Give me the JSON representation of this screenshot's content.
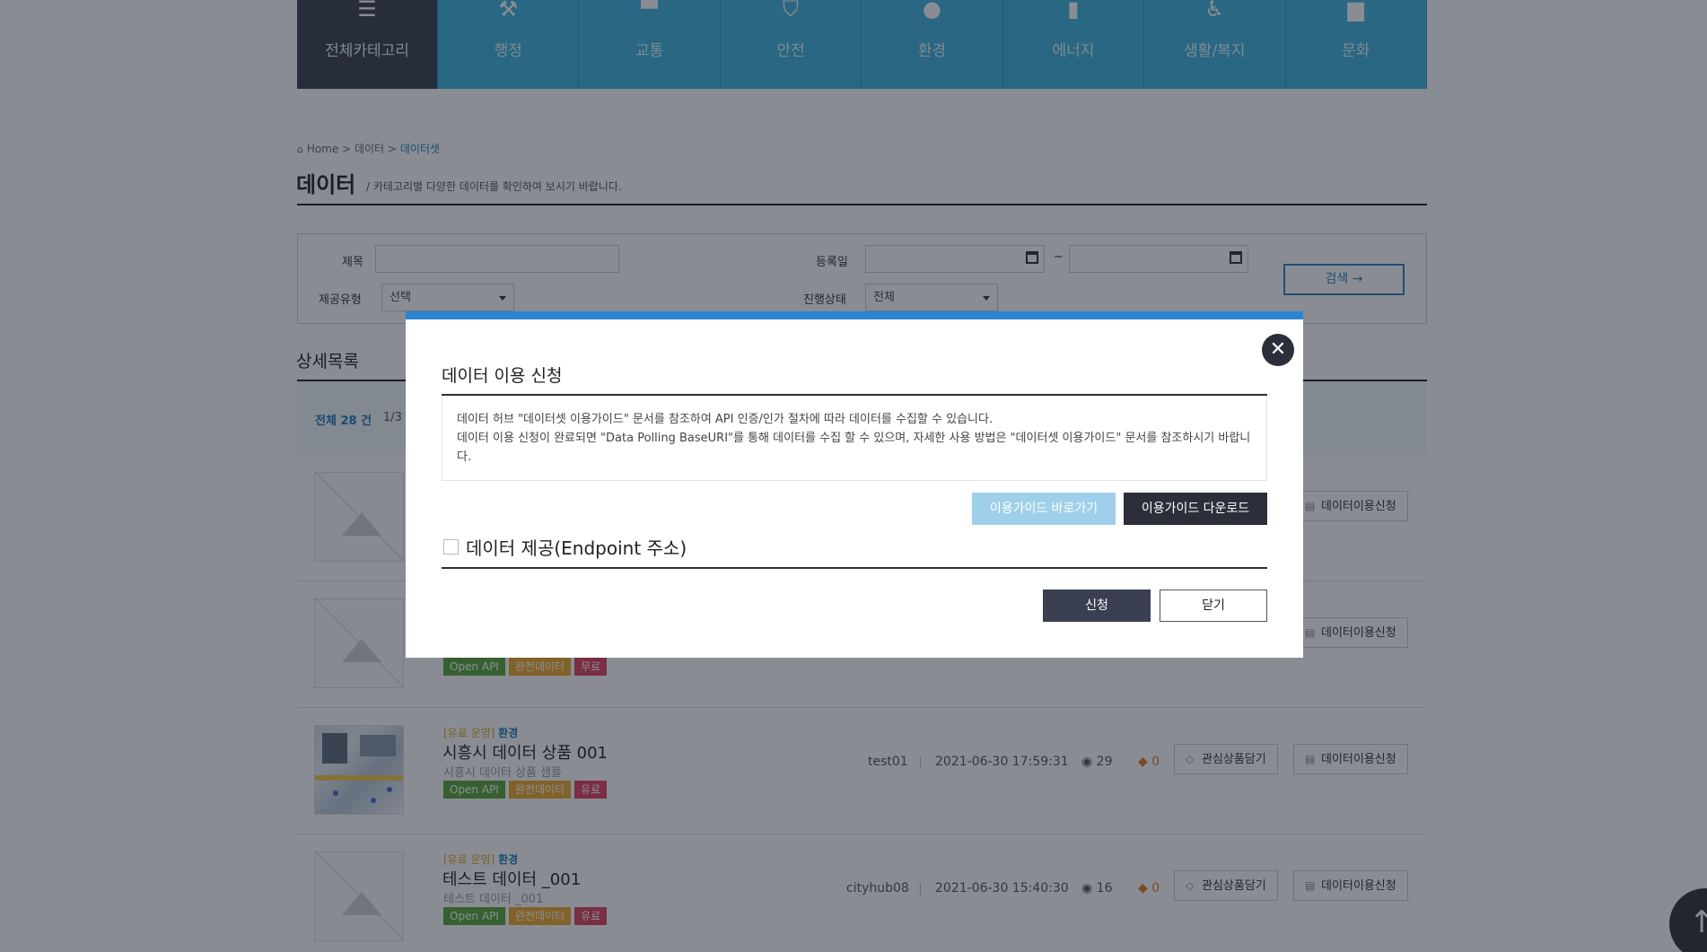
{
  "nav": {
    "categories": [
      {
        "label": "전체카테고리",
        "icon": "menu-icon"
      },
      {
        "label": "행정",
        "icon": "gavel-icon"
      },
      {
        "label": "교통",
        "icon": "bus-icon"
      },
      {
        "label": "안전",
        "icon": "shield-icon"
      },
      {
        "label": "환경",
        "icon": "leaf-icon"
      },
      {
        "label": "에너지",
        "icon": "battery-icon"
      },
      {
        "label": "생활/복지",
        "icon": "wheelchair-icon"
      },
      {
        "label": "문화",
        "icon": "museum-icon"
      }
    ]
  },
  "breadcrumb": {
    "home": "Home",
    "sep": ">",
    "level1": "데이터",
    "current": "데이터셋"
  },
  "page": {
    "title": "데이터",
    "desc_sep": "/",
    "description": "카테고리별 다양한 데이터를 확인하여 보시기 바랍니다."
  },
  "search": {
    "title_label": "제목",
    "title_value": "",
    "date_label": "등록일",
    "date_sep": "~",
    "type_label": "제공유형",
    "type_value": "선택",
    "status_label": "진행상태",
    "status_value": "전체",
    "button_label": "검색 →"
  },
  "list": {
    "title": "상세목록",
    "total": "전체 28 건",
    "page": "1/3"
  },
  "rows": [
    {
      "thumb": "placeholder",
      "user": "",
      "date": "",
      "views": "",
      "likes": "",
      "wish_label": "",
      "apply_label": "데이터이용신청"
    },
    {
      "thumb": "placeholder",
      "tags": [
        "Open API",
        "완전데이터",
        "무료"
      ],
      "user": "",
      "date": "",
      "views": "",
      "likes": "",
      "wish_label": "",
      "apply_label": "데이터이용신청"
    },
    {
      "thumb": "map",
      "category_prefix": "[유료 운영]",
      "category_field": "환경",
      "title": "시흥시 데이터 상품 001",
      "subtitle": "시흥시 데이터 상품 샘플",
      "tags": [
        "Open API",
        "완전데이터",
        "유료"
      ],
      "user": "test01",
      "date": "2021-06-30 17:59:31",
      "views": "29",
      "likes": "0",
      "wish_label": "관심상품담기",
      "apply_label": "데이터이용신청"
    },
    {
      "thumb": "placeholder",
      "category_prefix": "[유료 운영]",
      "category_field": "환경",
      "title": "테스트 데이터 _001",
      "subtitle": "테스트 데이터 _001",
      "tags": [
        "Open API",
        "완전데이터",
        "유료"
      ],
      "user": "cityhub08",
      "date": "2021-06-30 15:40:30",
      "views": "16",
      "likes": "0",
      "wish_label": "관심상품담기",
      "apply_label": "데이터이용신청"
    }
  ],
  "modal": {
    "title": "데이터 이용 신청",
    "desc_line1": "데이터 허브 \"데이터셋 이용가이드\" 문서를 참조하여 API 인증/인가 절차에 따라 데이터를 수집할 수 있습니다.",
    "desc_line2": "데이터 이용 신청이 완료되면 \"Data Polling BaseURI\"를 통해 데이터를 수집 할 수 있으며, 자세한 사용 방법은 \"데이터셋 이용가이드\" 문서를 참조하시기 바랍니다.",
    "guide_go_label": "이용가이드 바로가기",
    "guide_download_label": "이용가이드 다운로드",
    "checkbox_label": "데이터 제공(Endpoint 주소)",
    "checkbox_checked": false,
    "apply_label": "신청",
    "close_label": "닫기"
  },
  "colors": {
    "nav_bg": "#3fb2dc",
    "nav_active_bg": "#3a3f4f",
    "modal_top_border": "#2a85d0",
    "primary_dark": "#2c2f3a",
    "guide_button": "#9fd0ea",
    "link_blue": "#1a7ab8"
  }
}
